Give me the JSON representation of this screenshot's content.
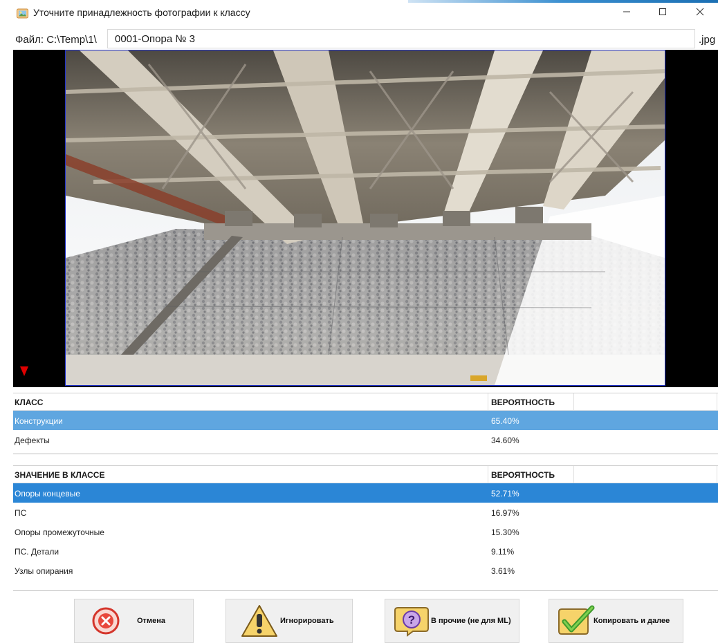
{
  "window": {
    "title": "Уточните принадлежность фотографии к классу",
    "controls": {
      "minimize": "–",
      "maximize": "☐",
      "close": "✕"
    }
  },
  "file": {
    "label": "Файл: C:\\Temp\\1\\",
    "name": "0001-Опора № 3",
    "extension": ".jpg"
  },
  "class_table": {
    "headers": {
      "class": "КЛАСС",
      "probability": "ВЕРОЯТНОСТЬ"
    },
    "rows": [
      {
        "name": "Конструкции",
        "probability": "65.40%",
        "selected": true
      },
      {
        "name": "Дефекты",
        "probability": "34.60%",
        "selected": false
      }
    ]
  },
  "value_table": {
    "headers": {
      "value": "ЗНАЧЕНИЕ В КЛАССЕ",
      "probability": "ВЕРОЯТНОСТЬ"
    },
    "rows": [
      {
        "name": "Опоры концевые",
        "probability": "52.71%",
        "selected": true
      },
      {
        "name": "ПС",
        "probability": "16.97%",
        "selected": false
      },
      {
        "name": "Опоры промежуточные",
        "probability": "15.30%",
        "selected": false
      },
      {
        "name": "ПС. Детали",
        "probability": "9.11%",
        "selected": false
      },
      {
        "name": "Узлы опирания",
        "probability": "3.61%",
        "selected": false
      }
    ]
  },
  "buttons": {
    "cancel": {
      "label": "Отмена",
      "icon": "cancel-x-icon"
    },
    "ignore": {
      "label": "Игнорировать",
      "icon": "warning-exclamation-icon"
    },
    "other": {
      "label": "В прочие (не для ML)",
      "icon": "question-icon"
    },
    "copy_next": {
      "label": "Копировать и далее",
      "icon": "checkmark-icon"
    }
  },
  "colors": {
    "selection_light": "#5fa6e0",
    "selection_strong": "#2b86d6",
    "photo_border": "#2233cc",
    "marker": "#e00000"
  }
}
